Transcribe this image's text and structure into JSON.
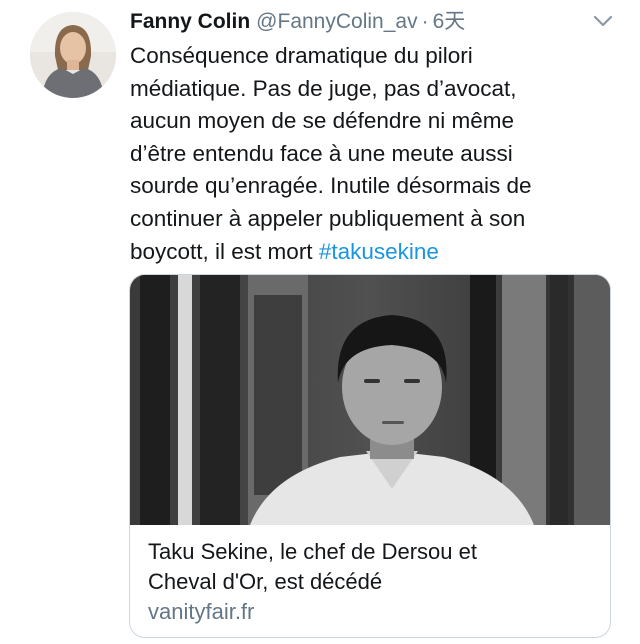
{
  "tweet": {
    "display_name": "Fanny Colin",
    "handle": "@FannyColin_av",
    "separator": "·",
    "time": "6天",
    "text_lines": [
      "Conséquence dramatique du pilori",
      "médiatique. Pas de juge, pas d’avocat,",
      "aucun moyen de se défendre ni même",
      "d’être entendu face à une meute aussi",
      "sourde qu’enragée. Inutile désormais de",
      "continuer à appeler publiquement à son",
      "boycott, il est mort"
    ],
    "hashtag": "#takusekine",
    "hashtag_color": "#1b95e0",
    "caret_icon": "chevron-down-icon"
  },
  "card": {
    "title_lines": [
      "Taku Sekine, le chef de Dersou et",
      "Cheval d'Or, est décédé"
    ],
    "domain": "vanityfair.fr"
  },
  "colors": {
    "text": "#14171a",
    "secondary": "#657786",
    "border": "#ccd6dd",
    "link": "#1b95e0"
  }
}
